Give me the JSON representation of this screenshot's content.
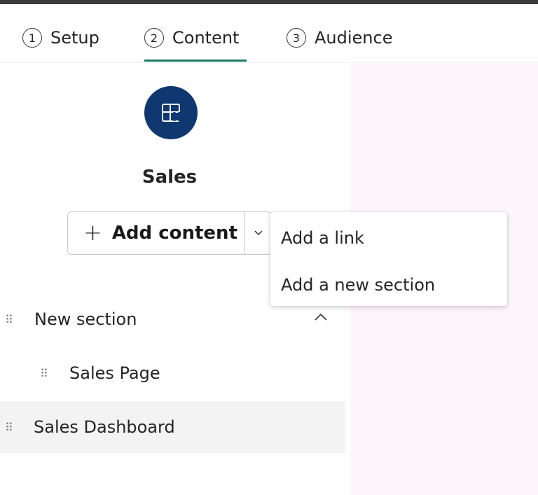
{
  "steps": [
    {
      "number": "1",
      "label": "Setup"
    },
    {
      "number": "2",
      "label": "Content"
    },
    {
      "number": "3",
      "label": "Audience"
    }
  ],
  "active_step": "Content",
  "app": {
    "name": "Sales",
    "icon": "layout-icon",
    "icon_bg": "#0f3870"
  },
  "add_button": {
    "label": "Add content",
    "icon": "plus-icon"
  },
  "dropdown_menu": {
    "items": [
      "Add a link",
      "Add a new section"
    ]
  },
  "nav_items": {
    "section": "New section",
    "page": "Sales Page",
    "dashboard": "Sales Dashboard"
  },
  "colors": {
    "accent": "#1b7a65",
    "selected_row": "#f3f3f3",
    "side_panel": "#fdf7fb"
  }
}
